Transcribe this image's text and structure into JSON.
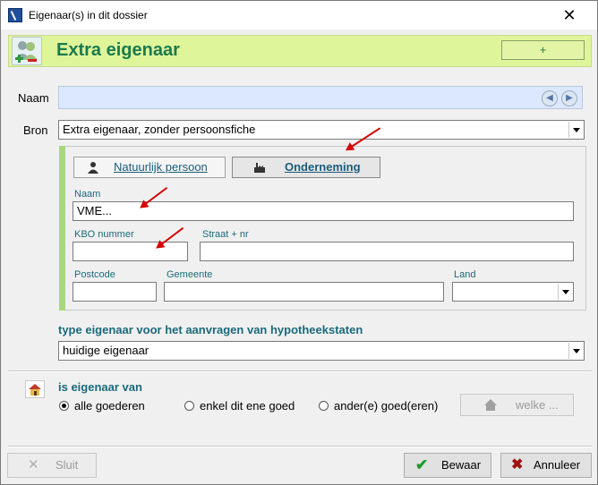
{
  "window": {
    "title": "Eigenaar(s) in dit dossier",
    "close_glyph": "✕"
  },
  "header": {
    "title": "Extra eigenaar",
    "plus_label": "+"
  },
  "naam": {
    "label": "Naam",
    "value": ""
  },
  "bron": {
    "label": "Bron",
    "value": "Extra eigenaar, zonder persoonsfiche"
  },
  "tabs": [
    {
      "label": "Natuurlijk persoon",
      "icon": "person-icon"
    },
    {
      "label": "Onderneming",
      "icon": "factory-icon"
    }
  ],
  "company": {
    "naam_label": "Naam",
    "naam_value": "VME...",
    "kbo_label": "KBO nummer",
    "kbo_value": "",
    "straat_label": "Straat + nr",
    "straat_value": "",
    "postcode_label": "Postcode",
    "postcode_value": "",
    "gemeente_label": "Gemeente",
    "gemeente_value": "",
    "land_label": "Land",
    "land_value": ""
  },
  "type_eigenaar": {
    "label": "type eigenaar voor het aanvragen van hypotheekstaten",
    "value": "huidige eigenaar"
  },
  "eigenaar_van": {
    "label": "is eigenaar van",
    "options": [
      "alle goederen",
      "enkel dit ene goed",
      "ander(e) goed(eren)"
    ],
    "selected": "alle goederen",
    "welke_label": "welke ..."
  },
  "footer": {
    "sluit_label": "Sluit",
    "bewaar_label": "Bewaar",
    "annuleer_label": "Annuleer"
  },
  "colors": {
    "accent_green": "#1a7a4e",
    "header_bg": "#dff59a",
    "section_teal": "#1a6a7a",
    "annotation_red": "#d40000"
  }
}
